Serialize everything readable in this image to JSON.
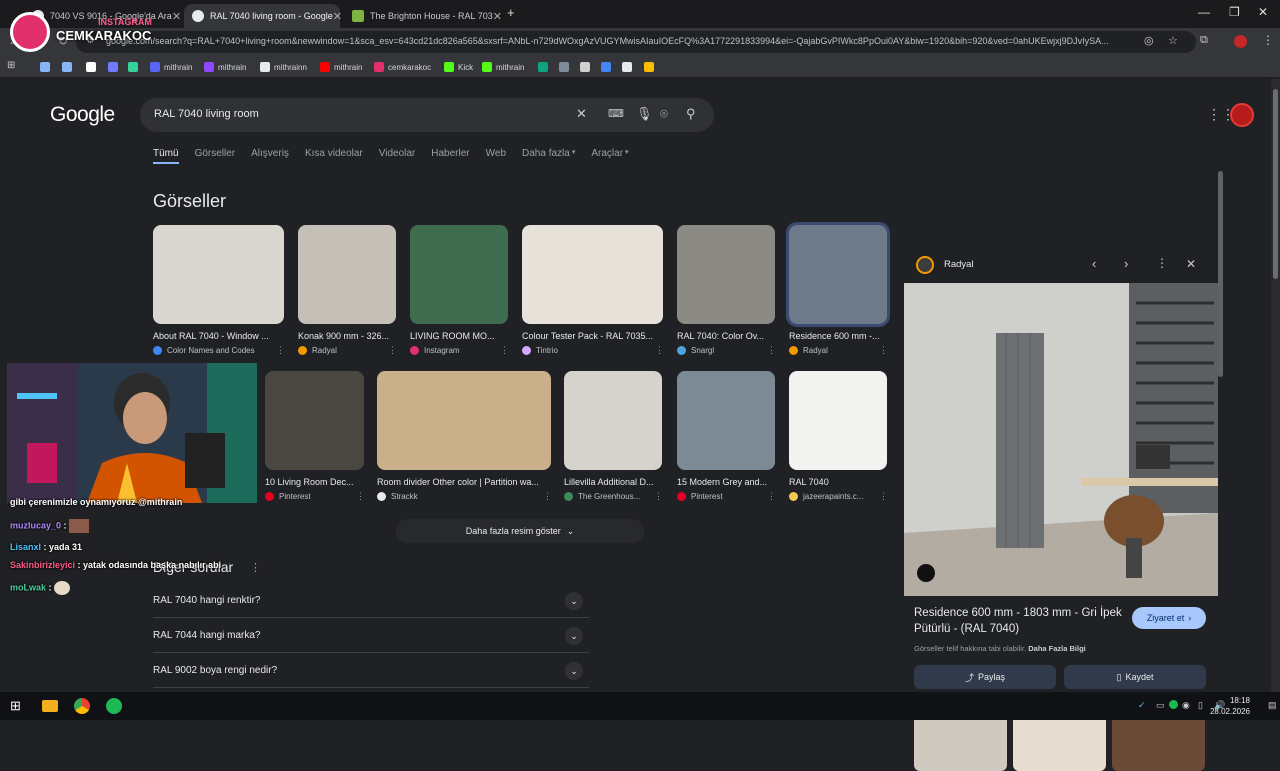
{
  "browser": {
    "tabs": [
      {
        "title": "7040 VS 9016 - Google'da Ara",
        "active": false
      },
      {
        "title": "RAL 7040 living room - Google",
        "active": true
      },
      {
        "title": "The Brighton House - RAL 703",
        "active": false
      }
    ],
    "new_tab": "+",
    "url": "google.com/search?q=RAL+7040+living+room&newwindow=1&sca_esv=643cd21dc826a565&sxsrf=ANbL-n729dWOxgAzVUGYMwisAIauIOEcFQ%3A1772291833994&ei=-QajabGvPIWkc8PpOui0AY&biw=1920&bih=920&ved=0ahUKEwjxj9DJvIySA...",
    "window_controls": {
      "minimize": "—",
      "restore": "❐",
      "close": "✕"
    }
  },
  "bookmarks": [
    {
      "label": "",
      "color": "#8ab4f8"
    },
    {
      "label": "",
      "color": "#8ab4f8"
    },
    {
      "label": "",
      "color": "#ffffff"
    },
    {
      "label": "",
      "color": "#6f7cff"
    },
    {
      "label": "",
      "color": "#34d399"
    },
    {
      "label": "mithrain",
      "color": "#5865f2"
    },
    {
      "label": "mithrain",
      "color": "#9146ff"
    },
    {
      "label": "mithrainn",
      "color": "#e8eaed"
    },
    {
      "label": "mithrain",
      "color": "#ff0000"
    },
    {
      "label": "cemkarakoc",
      "color": "#e1306c"
    },
    {
      "label": "Kick",
      "color": "#53fc18"
    },
    {
      "label": "mithrain",
      "color": "#53fc18"
    },
    {
      "label": "",
      "color": "#10a37f"
    },
    {
      "label": "",
      "color": "#7e8b9b"
    },
    {
      "label": "",
      "color": "#d0d0d0"
    },
    {
      "label": "",
      "color": "#4285f4"
    },
    {
      "label": "",
      "color": "#e8eaed"
    },
    {
      "label": "",
      "color": "#fbbc04"
    }
  ],
  "google": {
    "logo": "Google",
    "query": "RAL 7040 living room",
    "tabs": [
      "Tümü",
      "Görseller",
      "Alışveriş",
      "Kısa videolar",
      "Videolar",
      "Haberler",
      "Web",
      "Daha fazla",
      "Araçlar"
    ],
    "section_title": "Görseller",
    "images_row1": [
      {
        "caption": "About RAL 7040 - Window ...",
        "source": "Color Names and Codes",
        "color": "#4285f4"
      },
      {
        "caption": "Konak 900 mm - 326...",
        "source": "Radyal",
        "color": "#f29900"
      },
      {
        "caption": "LIVING ROOM MO...",
        "source": "Instagram",
        "color": "#e1306c"
      },
      {
        "caption": "Colour Tester Pack - RAL 7035...",
        "source": "Tintrio",
        "color": "#d6a8ff"
      },
      {
        "caption": "RAL 7040: Color Ov...",
        "source": "Snargl",
        "color": "#4fa3e0"
      },
      {
        "caption": "Residence 600 mm -...",
        "source": "Radyal",
        "color": "#f29900"
      }
    ],
    "images_row2": [
      {
        "caption": "10 Living Room Dec...",
        "source": "Pinterest",
        "color": "#e60023"
      },
      {
        "caption": "Room divider Other color | Partition wa...",
        "source": "Strackk",
        "color": "#e8eaed"
      },
      {
        "caption": "Lillevilla Additional D...",
        "source": "The Greenhous...",
        "color": "#3c8c5a"
      },
      {
        "caption": "15 Modern Grey and...",
        "source": "Pinterest",
        "color": "#e60023"
      },
      {
        "caption": "RAL 7040",
        "source": "jazeerapaints.c...",
        "color": "#f2c94c"
      }
    ],
    "more_images": "Daha fazla resim göster",
    "other_questions_title": "Diğer sorular",
    "questions": [
      "RAL 7040 hangi renktir?",
      "RAL 7044 hangi marka?",
      "RAL 9002 boya rengi nedir?"
    ]
  },
  "side_panel": {
    "source": "Radyal",
    "title": "Residence 600 mm - 1803 mm - Gri İpek Pütürlü - (RAL 7040)",
    "visit_button": "Ziyaret et",
    "copyright": "Görseller telif hakkına tabi olabilir.",
    "more_info": "Daha Fazla Bilgi",
    "share_button": "Paylaş",
    "save_button": "Kaydet"
  },
  "stream_overlay": {
    "instagram_label": "INSTAGRAM",
    "handle": "CEMKARAKOC",
    "chat": [
      {
        "user": "",
        "message": "gibi çerenimizle oynamıyoruz @mithrain",
        "color": "#ffffff"
      },
      {
        "user": "muzlucay_0",
        "message": "",
        "color": "#b388ff"
      },
      {
        "user": "Lisanxl",
        "message": "yada 31",
        "color": "#4fc3f7"
      },
      {
        "user": "Sakinbirizleyici",
        "message": "yatak odasında başka nabılır abi",
        "color": "#ff5c8a"
      },
      {
        "user": "moLwak",
        "message": "",
        "color": "#4dd0a1"
      }
    ]
  },
  "taskbar": {
    "time": "18:18",
    "date": "28.02.2026"
  }
}
